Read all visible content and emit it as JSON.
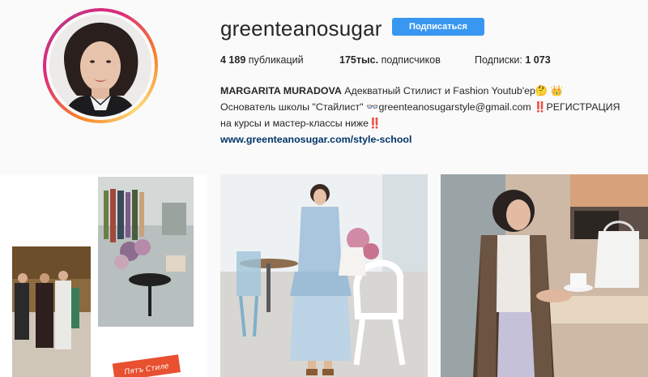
{
  "profile": {
    "username": "greenteanosugar",
    "follow_label": "Подписаться",
    "stats": {
      "posts_value": "4 189",
      "posts_label": "публикаций",
      "followers_value": "175тыс.",
      "followers_label": "подписчиков",
      "following_label": "Подписки:",
      "following_value": "1 073"
    },
    "bio": {
      "name": "MARGARITA MURADOVA",
      "line1_rest": " Адекватный Стилист и Fashion Youtub'ер🤔 👑",
      "line2": "Основатель школы \"Стайлист\" 👓greenteanosugarstyle@gmail.com ‼️РЕГИСТРАЦИЯ",
      "line3": "на курсы и мастер-классы ниже‼️",
      "link": "www.greenteanosugar.com/style-school"
    }
  },
  "posts": [
    {
      "sticker_text": "Пятъ Стиле"
    },
    {},
    {}
  ],
  "colors": {
    "accent": "#3897f0",
    "link": "#003569",
    "background": "#fafafa"
  }
}
